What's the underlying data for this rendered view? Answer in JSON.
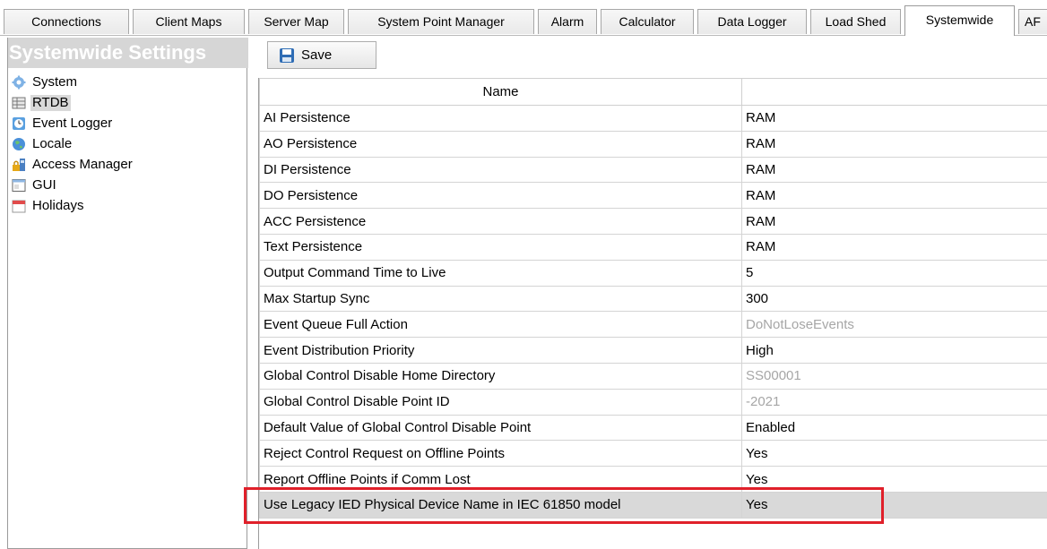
{
  "tabs": [
    {
      "label": "Connections",
      "active": false
    },
    {
      "label": "Client Maps",
      "active": false
    },
    {
      "label": "Server Map",
      "active": false
    },
    {
      "label": "System Point Manager",
      "active": false
    },
    {
      "label": "Alarm",
      "active": false
    },
    {
      "label": "Calculator",
      "active": false
    },
    {
      "label": "Data Logger",
      "active": false
    },
    {
      "label": "Load Shed",
      "active": false
    },
    {
      "label": "Systemwide",
      "active": true
    },
    {
      "label": "AF",
      "active": false
    }
  ],
  "left_panel": {
    "title": "Systemwide Settings",
    "items": [
      {
        "label": "System",
        "icon": "gear-icon",
        "selected": false
      },
      {
        "label": "RTDB",
        "icon": "database-icon",
        "selected": true
      },
      {
        "label": "Event Logger",
        "icon": "event-log-icon",
        "selected": false
      },
      {
        "label": "Locale",
        "icon": "globe-icon",
        "selected": false
      },
      {
        "label": "Access Manager",
        "icon": "lock-icon",
        "selected": false
      },
      {
        "label": "GUI",
        "icon": "window-icon",
        "selected": false
      },
      {
        "label": "Holidays",
        "icon": "calendar-icon",
        "selected": false
      }
    ]
  },
  "toolbar": {
    "save_label": "Save",
    "save_icon": "floppy-disk-icon"
  },
  "table": {
    "headers": [
      "Name",
      ""
    ],
    "rows": [
      {
        "name": "AI Persistence",
        "value": "RAM",
        "disabled": false
      },
      {
        "name": "AO Persistence",
        "value": "RAM",
        "disabled": false
      },
      {
        "name": "DI Persistence",
        "value": "RAM",
        "disabled": false
      },
      {
        "name": "DO Persistence",
        "value": "RAM",
        "disabled": false
      },
      {
        "name": "ACC Persistence",
        "value": "RAM",
        "disabled": false
      },
      {
        "name": "Text Persistence",
        "value": "RAM",
        "disabled": false
      },
      {
        "name": "Output Command Time to Live",
        "value": "5",
        "disabled": false
      },
      {
        "name": "Max Startup Sync",
        "value": "300",
        "disabled": false
      },
      {
        "name": "Event Queue Full Action",
        "value": "DoNotLoseEvents",
        "disabled": true
      },
      {
        "name": "Event Distribution Priority",
        "value": "High",
        "disabled": false
      },
      {
        "name": "Global Control Disable Home Directory",
        "value": "SS00001",
        "disabled": true
      },
      {
        "name": "Global Control Disable Point ID",
        "value": "-2021",
        "disabled": true
      },
      {
        "name": "Default Value of Global Control Disable Point",
        "value": "Enabled",
        "disabled": false
      },
      {
        "name": "Reject Control Request on Offline Points",
        "value": "Yes",
        "disabled": false
      },
      {
        "name": "Report Offline Points if Comm Lost",
        "value": "Yes",
        "disabled": false
      },
      {
        "name": "Use Legacy IED Physical Device Name in IEC 61850 model",
        "value": "Yes",
        "disabled": false,
        "selected": true
      }
    ]
  },
  "colors": {
    "highlight_border": "#e0202a",
    "selected_row": "#d9d9d9",
    "disabled_text": "#a6a6a6"
  }
}
